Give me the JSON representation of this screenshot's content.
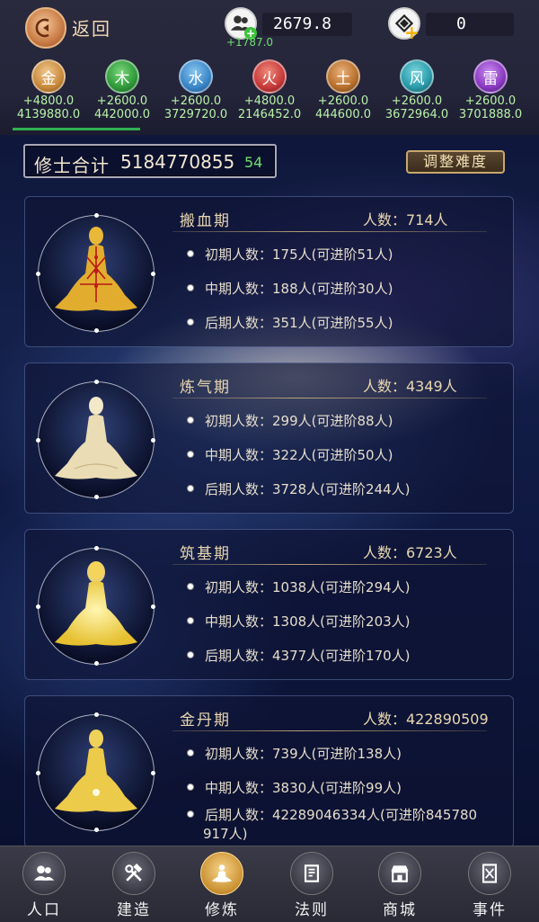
{
  "topbar": {
    "back_label": "返回",
    "population": {
      "value": "2679.8",
      "delta": "+1787.0"
    },
    "currency": {
      "value": "0"
    }
  },
  "elements": [
    {
      "name": "金",
      "color": "#c98a3a",
      "rate": "+4800.0",
      "total": "4139880.0"
    },
    {
      "name": "木",
      "color": "#2f9a3a",
      "rate": "+2600.0",
      "total": "442000.0"
    },
    {
      "name": "水",
      "color": "#3a86c8",
      "rate": "+2600.0",
      "total": "3729720.0"
    },
    {
      "name": "火",
      "color": "#c83a3a",
      "rate": "+4800.0",
      "total": "2146452.0"
    },
    {
      "name": "土",
      "color": "#b8702c",
      "rate": "+2600.0",
      "total": "444600.0"
    },
    {
      "name": "风",
      "color": "#2a9aa8",
      "rate": "+2600.0",
      "total": "3672964.0"
    },
    {
      "name": "雷",
      "color": "#8a3ac0",
      "rate": "+2600.0",
      "total": "3701888.0"
    }
  ],
  "summary": {
    "label": "修士合计",
    "value": "5184770855",
    "delta": "54",
    "difficulty_label": "调整难度"
  },
  "realms": [
    {
      "name": "搬血期",
      "count": "人数：714人",
      "stages": [
        "初期人数：175人(可进阶51人)",
        "中期人数：188人(可进阶30人)",
        "后期人数：351人(可进阶55人)"
      ]
    },
    {
      "name": "炼气期",
      "count": "人数：4349人",
      "stages": [
        "初期人数：299人(可进阶88人)",
        "中期人数：322人(可进阶50人)",
        "后期人数：3728人(可进阶244人)"
      ]
    },
    {
      "name": "筑基期",
      "count": "人数：6723人",
      "stages": [
        "初期人数：1038人(可进阶294人)",
        "中期人数：1308人(可进阶203人)",
        "后期人数：4377人(可进阶170人)"
      ]
    },
    {
      "name": "金丹期",
      "count": "人数：422890509",
      "stages": [
        "初期人数：739人(可进阶138人)",
        "中期人数：3830人(可进阶99人)",
        "后期人数：42289046334人(可进阶845780",
        "917人)"
      ]
    }
  ],
  "nav": [
    {
      "label": "人口",
      "icon": "people-icon"
    },
    {
      "label": "建造",
      "icon": "tools-icon"
    },
    {
      "label": "修炼",
      "icon": "meditate-icon",
      "active": true
    },
    {
      "label": "法则",
      "icon": "scroll-icon"
    },
    {
      "label": "商城",
      "icon": "shop-icon"
    },
    {
      "label": "事件",
      "icon": "event-icon"
    }
  ]
}
